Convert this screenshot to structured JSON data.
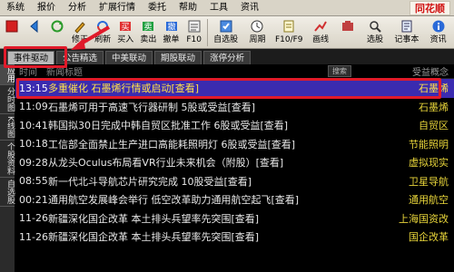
{
  "menu": {
    "items": [
      "系统",
      "报价",
      "分析",
      "扩展行情",
      "委托",
      "帮助",
      "工具",
      "资讯"
    ],
    "logo": "同花顺"
  },
  "toolbar": {
    "tools": [
      {
        "label": "",
        "icon": "red-square-icon"
      },
      {
        "label": "",
        "icon": "back-icon"
      },
      {
        "label": "",
        "icon": "refresh-icon"
      },
      {
        "label": "修正",
        "icon": "pen-icon"
      },
      {
        "label": "刷新",
        "icon": "cycle-icon"
      },
      {
        "label": "买入",
        "icon": "buy-icon"
      },
      {
        "label": "卖出",
        "icon": "sell-icon"
      },
      {
        "label": "撤单",
        "icon": "cancel-order-icon"
      },
      {
        "label": "F10",
        "icon": "f10-icon"
      }
    ],
    "tools2": [
      {
        "label": "自选股",
        "icon": "self-select-icon"
      },
      {
        "label": "周期",
        "icon": "period-icon"
      },
      {
        "label": "F10/F9",
        "icon": "notes-icon"
      },
      {
        "label": "画线",
        "icon": "draw-line-icon"
      },
      {
        "label": "",
        "icon": "tools-icon"
      },
      {
        "label": "选股",
        "icon": "stock-pick-icon"
      },
      {
        "label": "记事本",
        "icon": "notebook-icon"
      },
      {
        "label": "资讯",
        "icon": "info-icon"
      }
    ]
  },
  "subtabs": [
    "事件驱动",
    "公告精选",
    "中美联动",
    "期股联动",
    "涨停分析"
  ],
  "sidebar": [
    "应用",
    "分时图",
    "K线图",
    "个股资料",
    "自选股"
  ],
  "list": {
    "header_time": "时间",
    "header_title": "新闻标题",
    "header_button": "搜索",
    "header_concept": "受益概念",
    "rows": [
      {
        "time": "13:15",
        "title": "多重催化 石墨烯行情或启动",
        "view": "[查看]",
        "concept": "石墨烯",
        "selected": true
      },
      {
        "time": "11:09",
        "title": "石墨烯可用于高速飞行器研制 5股或受益",
        "view": "[查看]",
        "concept": "石墨烯",
        "selected": false
      },
      {
        "time": "10:41",
        "title": "韩国拟30日完成中韩自贸区批准工作 6股或受益",
        "view": "[查看]",
        "concept": "自贸区",
        "selected": false
      },
      {
        "time": "10:18",
        "title": "工信部全面禁止生产进口高能耗照明灯 6股或受益",
        "view": "[查看]",
        "concept": "节能照明",
        "selected": false
      },
      {
        "time": "09:28",
        "title": "从龙头Oculus布局看VR行业未来机会（附股）",
        "view": "[查看]",
        "concept": "虚拟现实",
        "selected": false
      },
      {
        "time": "08:55",
        "title": "新一代北斗导航芯片研究完成 10股受益",
        "view": "[查看]",
        "concept": "卫星导航",
        "selected": false
      },
      {
        "time": "00:21",
        "title": "通用航空发展峰会举行 低空改革助力通用航空起飞",
        "view": "[查看]",
        "concept": "通用航空",
        "selected": false
      },
      {
        "time": "11-26",
        "title": "新疆深化国企改革 本土排头兵望率先突围",
        "view": "[查看]",
        "concept": "上海国资改",
        "selected": false
      },
      {
        "time": "11-26",
        "title": "新疆深化国企改革 本土排头兵望率先突围",
        "view": "[查看]",
        "concept": "国企改革",
        "selected": false
      }
    ]
  },
  "colors": {
    "highlight": "#e01a2a",
    "selected_row": "#3a2bb0",
    "concept_text": "#e7d43a"
  }
}
